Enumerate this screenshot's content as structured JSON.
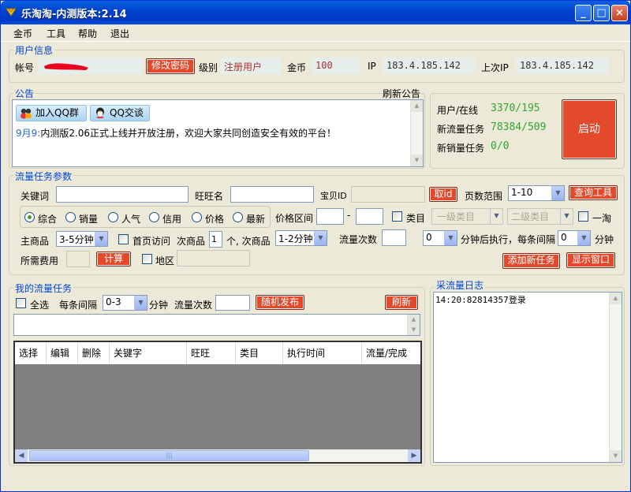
{
  "window": {
    "title": "乐淘淘-内测版本:2.14",
    "controls": {
      "minimize": "_",
      "maximize": "□",
      "close": "×"
    }
  },
  "menu": [
    "金币",
    "工具",
    "帮助",
    "退出"
  ],
  "user_info": {
    "group_title": "用户信息",
    "account_label": "帐号",
    "change_password_button": "修改密码",
    "level_label": "级别",
    "level_value": "注册用户",
    "coins_label": "金币",
    "coins_value": "100",
    "ip_label": "IP",
    "ip_value": "183.4.185.142",
    "last_ip_label": "上次IP",
    "last_ip_value": "183.4.185.142"
  },
  "announcement": {
    "group_title": "公告",
    "refresh_label": "刷新公告",
    "join_qq_group": "加入QQ群",
    "qq_chat": "QQ交谈",
    "date": "9月9:",
    "text": "内测版2.06正式上线并开放注册，欢迎大家共同创造安全有效的平台！"
  },
  "stats": {
    "users_online_label": "用户/在线",
    "users_online_value": "3370/195",
    "new_traffic_label": "新流量任务",
    "new_traffic_value": "78384/509",
    "new_sales_label": "新销量任务",
    "new_sales_value": "0/0",
    "start_button": "启动"
  },
  "params": {
    "group_title": "流量任务参数",
    "keyword_label": "关键词",
    "wangwang_label": "旺旺名",
    "item_id_label": "宝贝ID",
    "get_id_button": "取id",
    "page_range_label": "页数范围",
    "page_range_value": "1-10",
    "query_tool_button": "查询工具",
    "sort_options": [
      "综合",
      "销量",
      "人气",
      "信用",
      "价格",
      "最新"
    ],
    "sort_selected": "综合",
    "price_range_label": "价格区间",
    "price_dash": "-",
    "category_label": "类目",
    "category1_value": "一级类目",
    "category2_value": "二级类目",
    "yitao_label": "一淘",
    "main_item_label": "主商品",
    "main_item_value": "3-5分钟",
    "homepage_visit_label": "首页访问",
    "sub_item_label": "次商品",
    "sub_item_count": "1",
    "sub_item_unit": "个, 次商品",
    "sub_item_value": "1-2分钟",
    "traffic_count_label": "流量次数",
    "delay_value": "0",
    "delay_label": "分钟后执行，每条间隔",
    "interval_value": "0",
    "interval_unit": "分钟",
    "cost_label": "所需费用",
    "calc_button": "计算",
    "region_label": "地区",
    "add_task_button": "添加新任务",
    "show_window_button": "显示窗口"
  },
  "my_tasks": {
    "group_title": "我的流量任务",
    "select_all_label": "全选",
    "interval_label": "每条间隔",
    "interval_value": "0-3",
    "minutes_label": "分钟",
    "traffic_count_label": "流量次数",
    "random_publish_button": "随机发布",
    "refresh_button": "刷新",
    "columns": [
      "选择",
      "编辑",
      "删除",
      "关键字",
      "旺旺",
      "类目",
      "执行时间",
      "流量/完成"
    ]
  },
  "log": {
    "group_title": "采流量日志",
    "entries": [
      "14:20:82814357登录"
    ]
  },
  "colors": {
    "accent_red": "#E34A2C",
    "title_blue": "#0046D5",
    "stat_green": "#2fa82f"
  }
}
